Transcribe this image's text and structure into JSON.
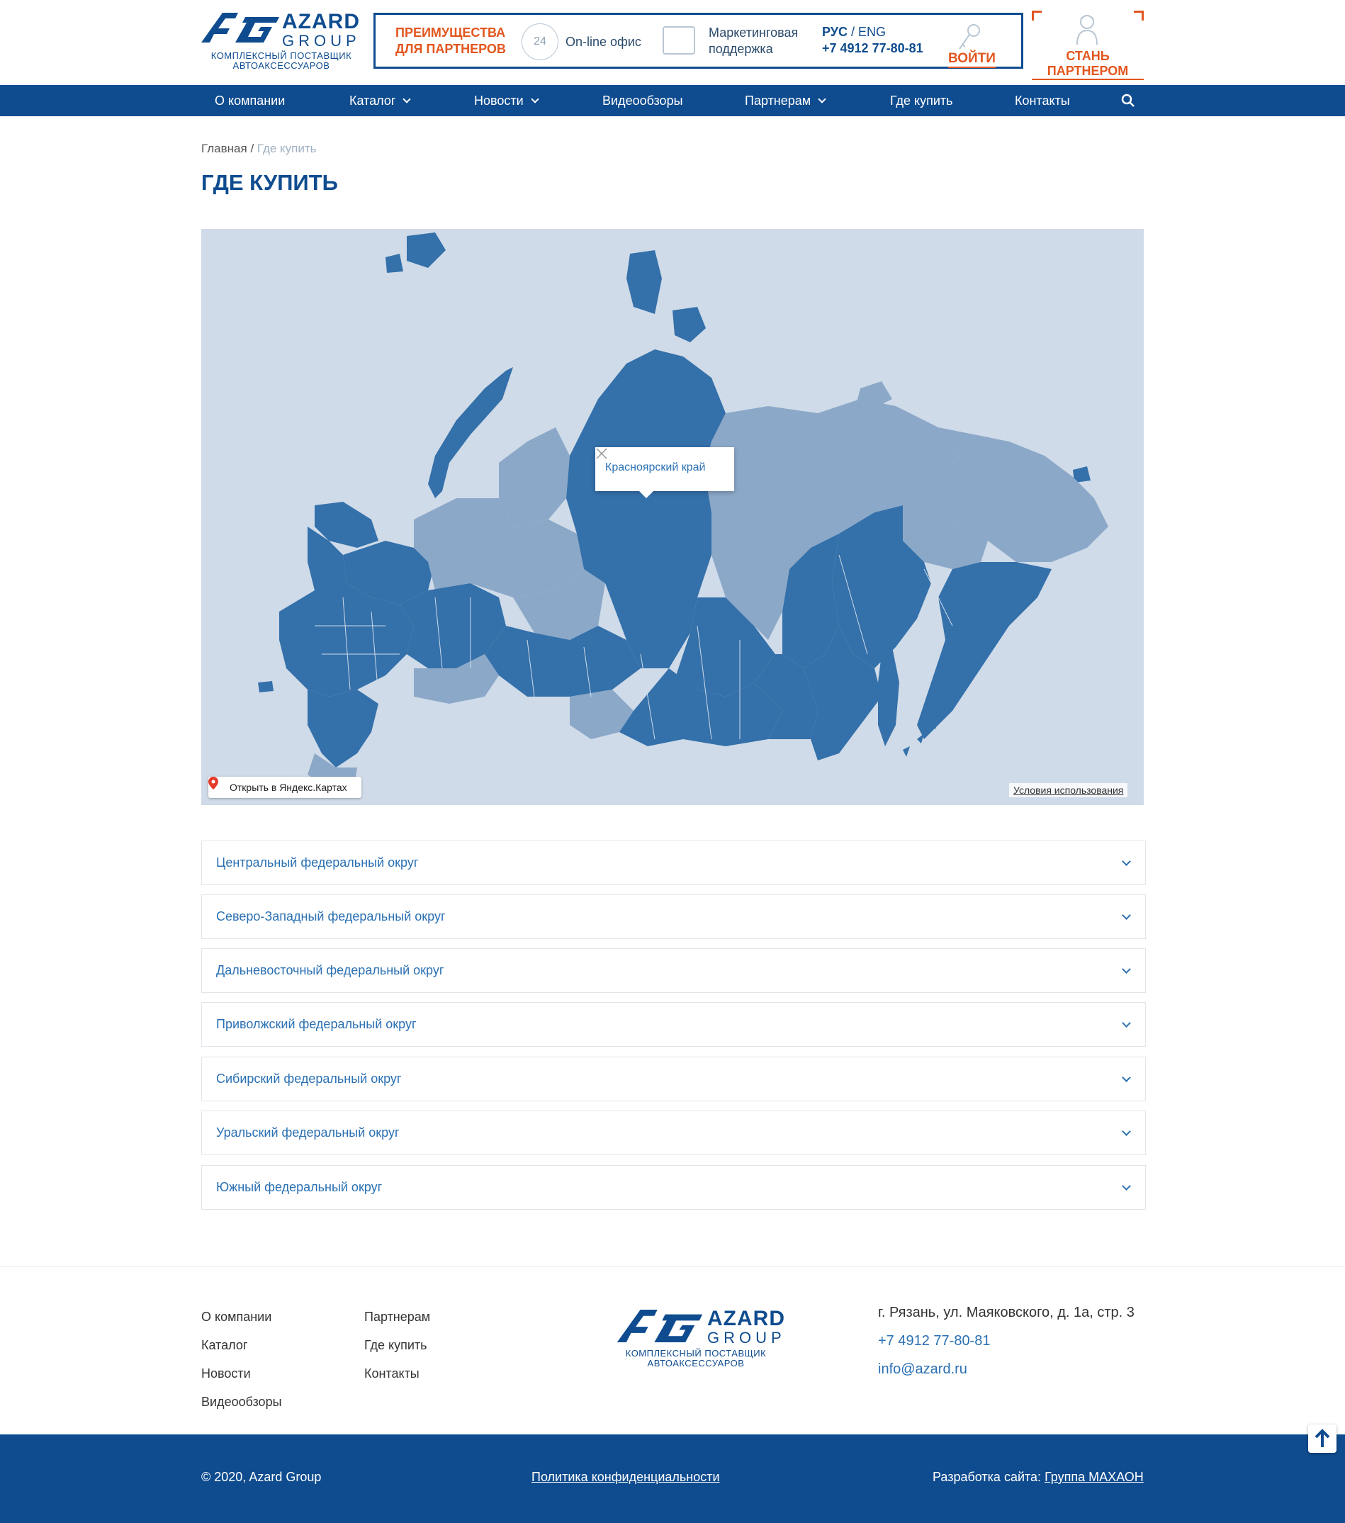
{
  "header": {
    "logo": {
      "brand": "AZARD",
      "group": "GROUP",
      "tagline_1": "КОМПЛЕКСНЫЙ ПОСТАВЩИК",
      "tagline_2": "АВТОАКСЕССУАРОВ"
    },
    "advantages_1": "ПРЕИМУЩЕСТВА",
    "advantages_2": "ДЛЯ ПАРТНЕРОВ",
    "icon_24": "24",
    "online_office": "On-line офис",
    "marketing_1": "Маркетинговая",
    "marketing_2": "поддержка",
    "lang_ru": "РУС",
    "lang_sep": " / ",
    "lang_en": "ENG",
    "phone": "+7 4912 77-80-81",
    "login": "ВОЙТИ",
    "become_partner": "СТАНЬ ПАРТНЕРОМ"
  },
  "nav": {
    "items": [
      {
        "label": "О компании"
      },
      {
        "label": "Каталог"
      },
      {
        "label": "Новости"
      },
      {
        "label": "Видеообзоры"
      },
      {
        "label": "Партнерам"
      },
      {
        "label": "Где купить"
      },
      {
        "label": "Контакты"
      }
    ]
  },
  "breadcrumb": {
    "home": "Главная",
    "sep": " / ",
    "current": "Где купить"
  },
  "page_title": "ГДЕ КУПИТЬ",
  "map": {
    "balloon": "Красноярский край",
    "open_in_yandex": "Открыть в Яндекс.Картах",
    "terms": "Условия использования",
    "colors": {
      "dark": "#3470aa",
      "light": "#8ba8c8",
      "water": "#cfdbe8"
    }
  },
  "districts": [
    "Центральный федеральный округ",
    "Северо-Западный федеральный округ",
    "Дальневосточный федеральный округ",
    "Приволжский федеральный округ",
    "Сибирский федеральный округ",
    "Уральский федеральный округ",
    "Южный федеральный округ"
  ],
  "footer": {
    "col1": [
      "О компании",
      "Каталог",
      "Новости",
      "Видеообзоры"
    ],
    "col2": [
      "Партнерам",
      "Где купить",
      "Контакты"
    ],
    "address": "г. Рязань, ул. Маяковского, д. 1а, стр. 3",
    "phone": "+7 4912 77-80-81",
    "email": "info@azard.ru",
    "copyright": "© 2020, Azard Group",
    "policy": "Политика конфиденциальности",
    "dev_prefix": "Разработка сайта: ",
    "dev_link": "Группа МАХАОН"
  },
  "colors": {
    "brand": "#0f4c8f",
    "accent": "#e2561e",
    "link": "#2a70b3"
  }
}
